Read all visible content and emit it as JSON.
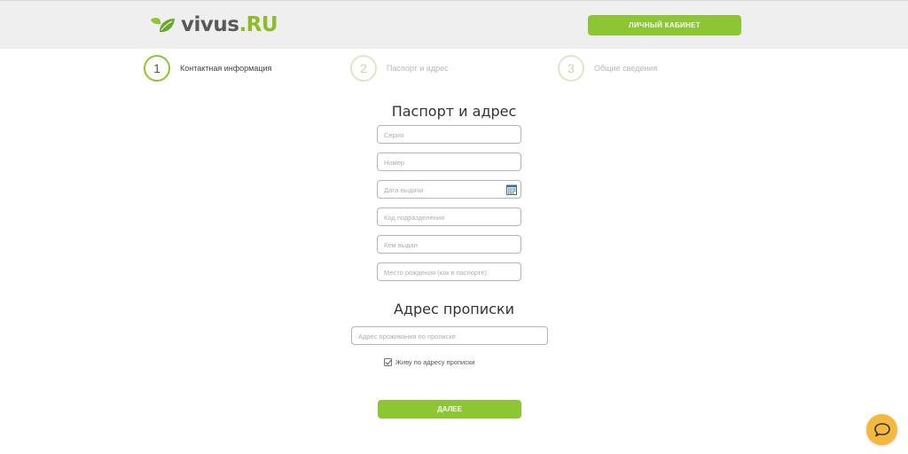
{
  "header": {
    "logo_text": "vivus",
    "logo_domain": ".ru",
    "cabinet_button": "ЛИЧНЫЙ КАБИНЕТ"
  },
  "steps": [
    {
      "number": "1",
      "label": "Контактная информация",
      "state": "active"
    },
    {
      "number": "2",
      "label": "Паспорт и адрес",
      "state": "inactive"
    },
    {
      "number": "3",
      "label": "Общие сведения",
      "state": "inactive"
    }
  ],
  "passport": {
    "title": "Паспорт и адрес",
    "fields": {
      "series": {
        "placeholder": "Серия",
        "value": ""
      },
      "number": {
        "placeholder": "Номер",
        "value": ""
      },
      "issue_date": {
        "placeholder": "Дата выдачи",
        "value": ""
      },
      "division_code": {
        "placeholder": "Код подразделения",
        "value": ""
      },
      "issued_by": {
        "placeholder": "Кем выдан",
        "value": ""
      },
      "birth_place": {
        "placeholder": "Место рождения (как в паспорте)",
        "value": ""
      }
    }
  },
  "registration": {
    "title": "Адрес прописки",
    "address_placeholder": "Адрес проживания по прописке",
    "same_address_label": "Живу по адресу прописки",
    "same_address_checked": true
  },
  "next_button": "ДАЛЕЕ",
  "colors": {
    "accent": "#8cc633",
    "chat": "#f4b83c"
  },
  "icons": {
    "calendar": "calendar-icon",
    "chat": "chat-icon"
  }
}
